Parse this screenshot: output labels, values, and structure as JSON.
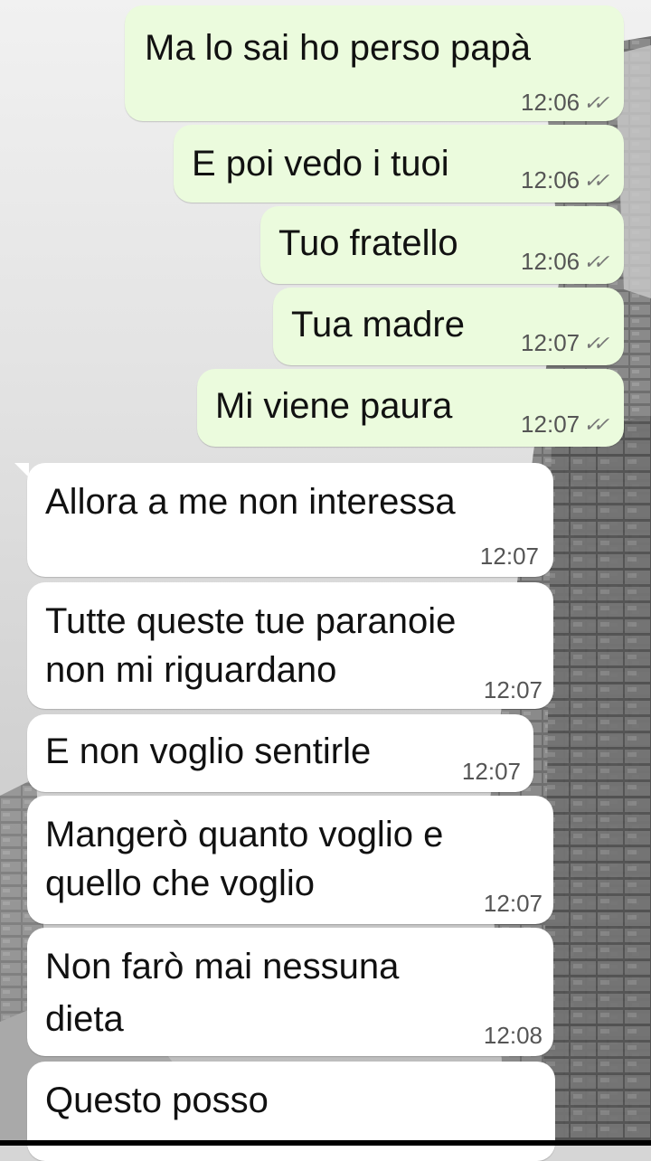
{
  "chat": {
    "outgoing": [
      {
        "text": "Ma lo sai ho perso papà",
        "time": "12:06",
        "status": "read"
      },
      {
        "text": "E poi vedo i tuoi",
        "time": "12:06",
        "status": "read"
      },
      {
        "text": "Tuo fratello",
        "time": "12:06",
        "status": "read"
      },
      {
        "text": "Tua madre",
        "time": "12:07",
        "status": "read"
      },
      {
        "text": "Mi viene paura",
        "time": "12:07",
        "status": "read"
      }
    ],
    "incoming": [
      {
        "text": "Allora a me non interessa",
        "time": "12:07"
      },
      {
        "line1": "Tutte queste tue paranoie",
        "line2": "non mi riguardano",
        "time": "12:07"
      },
      {
        "text": "E non voglio sentirle",
        "time": "12:07"
      },
      {
        "line1": "Mangerò quanto voglio e",
        "line2": "quello che voglio",
        "time": "12:07"
      },
      {
        "line1": "Non farò mai nessuna",
        "line2": "dieta",
        "time": "12:08"
      },
      {
        "text": "Questo posso"
      }
    ]
  },
  "icons": {
    "read_receipt": "double-check-icon"
  },
  "colors": {
    "outgoing_bubble": "#ebfbdd",
    "incoming_bubble": "#ffffff",
    "meta_text": "#555555"
  }
}
